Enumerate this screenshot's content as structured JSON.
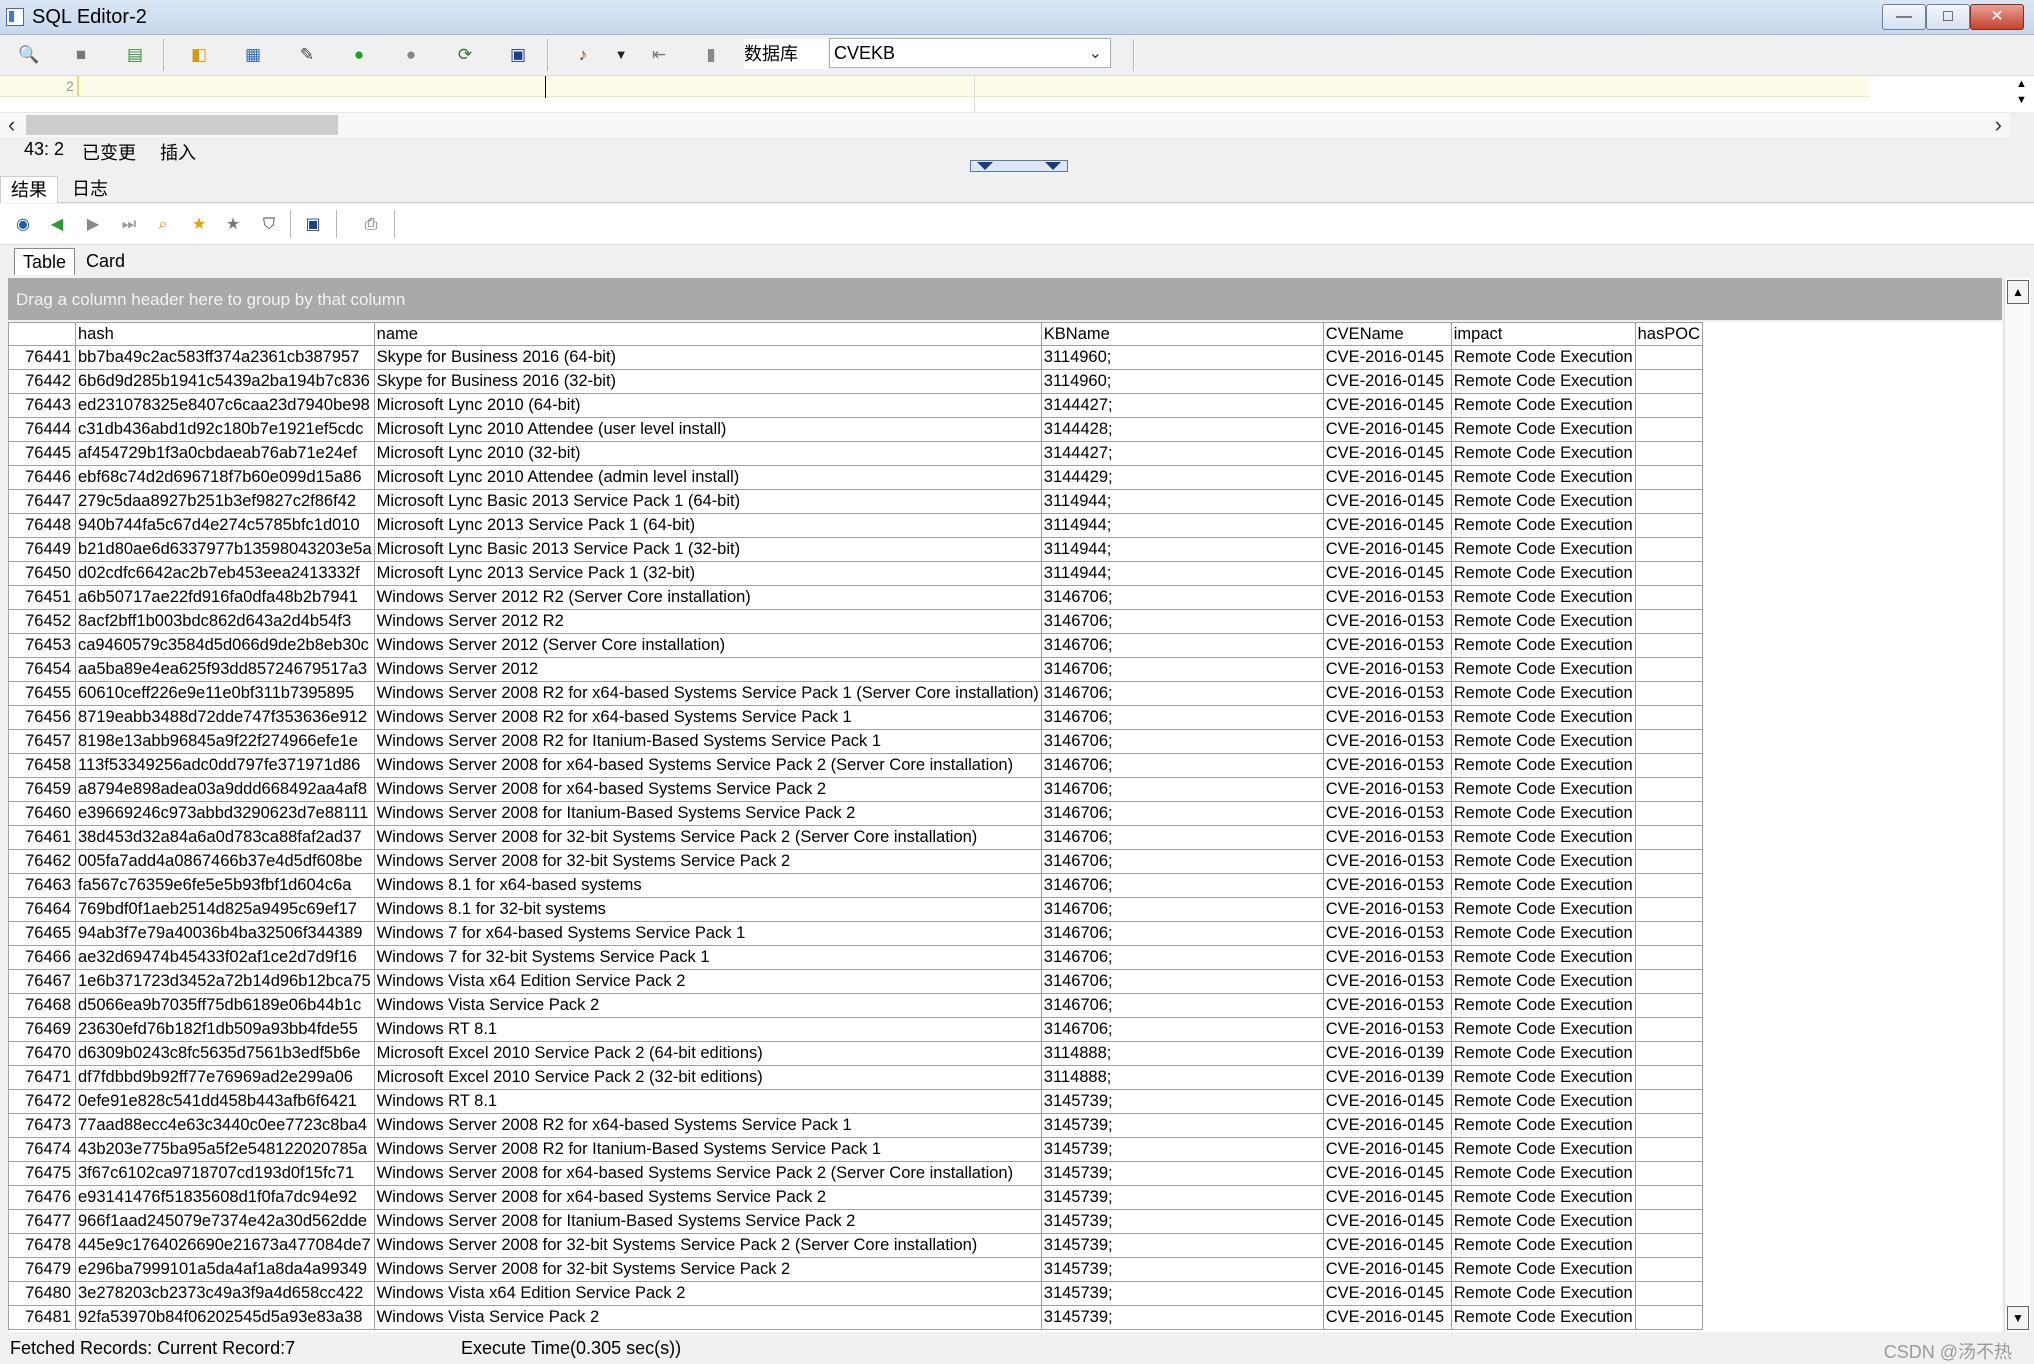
{
  "window": {
    "title": "SQL Editor-2",
    "minimize": "—",
    "maximize": "□",
    "close": "✕"
  },
  "toolbar": {
    "icons": [
      "open-file-icon",
      "save-icon",
      "format-icon",
      "explain-icon",
      "table-icon",
      "script-icon",
      "run-icon",
      "stop-icon",
      "refresh-icon",
      "disk-save-icon",
      "commit-icon",
      "dropdown-icon",
      "export-icon",
      "trash-icon"
    ],
    "database_label": "数据库",
    "database_value": "CVEKB"
  },
  "editor": {
    "line_number": "2"
  },
  "status": {
    "position": "43: 2",
    "modified": "已变更",
    "mode": "插入"
  },
  "tabs": [
    {
      "label": "结果"
    },
    {
      "label": "日志"
    }
  ],
  "view_tabs": [
    {
      "label": "Table"
    },
    {
      "label": "Card"
    }
  ],
  "group_panel": "Drag a column header here to group by that column",
  "table": {
    "columns": [
      "",
      "hash",
      "name",
      "KBName",
      "CVEName",
      "impact",
      "hasPOC"
    ],
    "rows": [
      [
        "76441",
        "bb7ba49c2ac583ff374a2361cb387957",
        "Skype for Business 2016 (64-bit)",
        "3114960;",
        "CVE-2016-0145",
        "Remote Code Execution",
        ""
      ],
      [
        "76442",
        "6b6d9d285b1941c5439a2ba194b7c836",
        "Skype for Business 2016 (32-bit)",
        "3114960;",
        "CVE-2016-0145",
        "Remote Code Execution",
        ""
      ],
      [
        "76443",
        "ed231078325e8407c6caa23d7940be98",
        "Microsoft Lync 2010 (64-bit)",
        "3144427;",
        "CVE-2016-0145",
        "Remote Code Execution",
        ""
      ],
      [
        "76444",
        "c31db436abd1d92c180b7e1921ef5cdc",
        "Microsoft Lync 2010 Attendee (user level install)",
        "3144428;",
        "CVE-2016-0145",
        "Remote Code Execution",
        ""
      ],
      [
        "76445",
        "af454729b1f3a0cbdaeab76ab71e24ef",
        "Microsoft Lync 2010 (32-bit)",
        "3144427;",
        "CVE-2016-0145",
        "Remote Code Execution",
        ""
      ],
      [
        "76446",
        "ebf68c74d2d696718f7b60e099d15a86",
        "Microsoft Lync 2010 Attendee (admin level install)",
        "3144429;",
        "CVE-2016-0145",
        "Remote Code Execution",
        ""
      ],
      [
        "76447",
        "279c5daa8927b251b3ef9827c2f86f42",
        "Microsoft Lync Basic 2013 Service Pack 1 (64-bit)",
        "3114944;",
        "CVE-2016-0145",
        "Remote Code Execution",
        ""
      ],
      [
        "76448",
        "940b744fa5c67d4e274c5785bfc1d010",
        "Microsoft Lync 2013 Service Pack 1 (64-bit)",
        "3114944;",
        "CVE-2016-0145",
        "Remote Code Execution",
        ""
      ],
      [
        "76449",
        "b21d80ae6d6337977b13598043203e5a",
        "Microsoft Lync Basic 2013 Service Pack 1 (32-bit)",
        "3114944;",
        "CVE-2016-0145",
        "Remote Code Execution",
        ""
      ],
      [
        "76450",
        "d02cdfc6642ac2b7eb453eea2413332f",
        "Microsoft Lync 2013 Service Pack 1 (32-bit)",
        "3114944;",
        "CVE-2016-0145",
        "Remote Code Execution",
        ""
      ],
      [
        "76451",
        "a6b50717ae22fd916fa0dfa48b2b7941",
        "Windows Server 2012 R2 (Server Core installation)",
        "3146706;",
        "CVE-2016-0153",
        "Remote Code Execution",
        ""
      ],
      [
        "76452",
        "8acf2bff1b003bdc862d643a2d4b54f3",
        "Windows Server 2012 R2",
        "3146706;",
        "CVE-2016-0153",
        "Remote Code Execution",
        ""
      ],
      [
        "76453",
        "ca9460579c3584d5d066d9de2b8eb30c",
        "Windows Server 2012 (Server Core installation)",
        "3146706;",
        "CVE-2016-0153",
        "Remote Code Execution",
        ""
      ],
      [
        "76454",
        "aa5ba89e4ea625f93dd85724679517a3",
        "Windows Server 2012",
        "3146706;",
        "CVE-2016-0153",
        "Remote Code Execution",
        ""
      ],
      [
        "76455",
        "60610ceff226e9e11e0bf311b7395895",
        "Windows Server 2008 R2 for x64-based Systems Service Pack 1 (Server Core installation)",
        "3146706;",
        "CVE-2016-0153",
        "Remote Code Execution",
        ""
      ],
      [
        "76456",
        "8719eabb3488d72dde747f353636e912",
        "Windows Server 2008 R2 for x64-based Systems Service Pack 1",
        "3146706;",
        "CVE-2016-0153",
        "Remote Code Execution",
        ""
      ],
      [
        "76457",
        "8198e13abb96845a9f22f274966efe1e",
        "Windows Server 2008 R2 for Itanium-Based Systems Service Pack 1",
        "3146706;",
        "CVE-2016-0153",
        "Remote Code Execution",
        ""
      ],
      [
        "76458",
        "113f53349256adc0dd797fe371971d86",
        "Windows Server 2008 for x64-based Systems Service Pack 2 (Server Core installation)",
        "3146706;",
        "CVE-2016-0153",
        "Remote Code Execution",
        ""
      ],
      [
        "76459",
        "a8794e898adea03a9ddd668492aa4af8",
        "Windows Server 2008 for x64-based Systems Service Pack 2",
        "3146706;",
        "CVE-2016-0153",
        "Remote Code Execution",
        ""
      ],
      [
        "76460",
        "e39669246c973abbd3290623d7e88111",
        "Windows Server 2008 for Itanium-Based Systems Service Pack 2",
        "3146706;",
        "CVE-2016-0153",
        "Remote Code Execution",
        ""
      ],
      [
        "76461",
        "38d453d32a84a6a0d783ca88faf2ad37",
        "Windows Server 2008 for 32-bit Systems Service Pack 2 (Server Core installation)",
        "3146706;",
        "CVE-2016-0153",
        "Remote Code Execution",
        ""
      ],
      [
        "76462",
        "005fa7add4a0867466b37e4d5df608be",
        "Windows Server 2008 for 32-bit Systems Service Pack 2",
        "3146706;",
        "CVE-2016-0153",
        "Remote Code Execution",
        ""
      ],
      [
        "76463",
        "fa567c76359e6fe5e5b93fbf1d604c6a",
        "Windows 8.1 for x64-based systems",
        "3146706;",
        "CVE-2016-0153",
        "Remote Code Execution",
        ""
      ],
      [
        "76464",
        "769bdf0f1aeb2514d825a9495c69ef17",
        "Windows 8.1 for 32-bit systems",
        "3146706;",
        "CVE-2016-0153",
        "Remote Code Execution",
        ""
      ],
      [
        "76465",
        "94ab3f7e79a40036b4ba32506f344389",
        "Windows 7 for x64-based Systems Service Pack 1",
        "3146706;",
        "CVE-2016-0153",
        "Remote Code Execution",
        ""
      ],
      [
        "76466",
        "ae32d69474b45433f02af1ce2d7d9f16",
        "Windows 7 for 32-bit Systems Service Pack 1",
        "3146706;",
        "CVE-2016-0153",
        "Remote Code Execution",
        ""
      ],
      [
        "76467",
        "1e6b371723d3452a72b14d96b12bca75",
        "Windows Vista x64 Edition Service Pack 2",
        "3146706;",
        "CVE-2016-0153",
        "Remote Code Execution",
        ""
      ],
      [
        "76468",
        "d5066ea9b7035ff75db6189e06b44b1c",
        "Windows Vista Service Pack 2",
        "3146706;",
        "CVE-2016-0153",
        "Remote Code Execution",
        ""
      ],
      [
        "76469",
        "23630efd76b182f1db509a93bb4fde55",
        "Windows RT 8.1",
        "3146706;",
        "CVE-2016-0153",
        "Remote Code Execution",
        ""
      ],
      [
        "76470",
        "d6309b0243c8fc5635d7561b3edf5b6e",
        "Microsoft Excel 2010 Service Pack 2 (64-bit editions)",
        "3114888;",
        "CVE-2016-0139",
        "Remote Code Execution",
        ""
      ],
      [
        "76471",
        "df7fdbbd9b92ff77e76969ad2e299a06",
        "Microsoft Excel 2010 Service Pack 2 (32-bit editions)",
        "3114888;",
        "CVE-2016-0139",
        "Remote Code Execution",
        ""
      ],
      [
        "76472",
        "0efe91e828c541dd458b443afb6f6421",
        "Windows RT 8.1",
        "3145739;",
        "CVE-2016-0145",
        "Remote Code Execution",
        ""
      ],
      [
        "76473",
        "77aad88ecc4e63c3440c0ee7723c8ba4",
        "Windows Server 2008 R2 for x64-based Systems Service Pack 1",
        "3145739;",
        "CVE-2016-0145",
        "Remote Code Execution",
        ""
      ],
      [
        "76474",
        "43b203e775ba95a5f2e548122020785a",
        "Windows Server 2008 R2 for Itanium-Based Systems Service Pack 1",
        "3145739;",
        "CVE-2016-0145",
        "Remote Code Execution",
        ""
      ],
      [
        "76475",
        "3f67c6102ca9718707cd193d0f15fc71",
        "Windows Server 2008 for x64-based Systems Service Pack 2 (Server Core installation)",
        "3145739;",
        "CVE-2016-0145",
        "Remote Code Execution",
        ""
      ],
      [
        "76476",
        "e93141476f51835608d1f0fa7dc94e92",
        "Windows Server 2008 for x64-based Systems Service Pack 2",
        "3145739;",
        "CVE-2016-0145",
        "Remote Code Execution",
        ""
      ],
      [
        "76477",
        "966f1aad245079e7374e42a30d562dde",
        "Windows Server 2008 for Itanium-Based Systems Service Pack 2",
        "3145739;",
        "CVE-2016-0145",
        "Remote Code Execution",
        ""
      ],
      [
        "76478",
        "445e9c1764026690e21673a477084de7",
        "Windows Server 2008 for 32-bit Systems Service Pack 2 (Server Core installation)",
        "3145739;",
        "CVE-2016-0145",
        "Remote Code Execution",
        ""
      ],
      [
        "76479",
        "e296ba7999101a5da4af1a8da4a99349",
        "Windows Server 2008 for 32-bit Systems Service Pack 2",
        "3145739;",
        "CVE-2016-0145",
        "Remote Code Execution",
        ""
      ],
      [
        "76480",
        "3e278203cb2373c49a3f9a4d658cc422",
        "Windows Vista x64 Edition Service Pack 2",
        "3145739;",
        "CVE-2016-0145",
        "Remote Code Execution",
        ""
      ],
      [
        "76481",
        "92fa53970b84f06202545d5a93e83a38",
        "Windows Vista Service Pack 2",
        "3145739;",
        "CVE-2016-0145",
        "Remote Code Execution",
        ""
      ]
    ]
  },
  "footer": {
    "records": "Fetched Records: Current Record:7",
    "exec_time": "Execute Time(0.305 sec(s))",
    "watermark": "CSDN @汤不热"
  }
}
